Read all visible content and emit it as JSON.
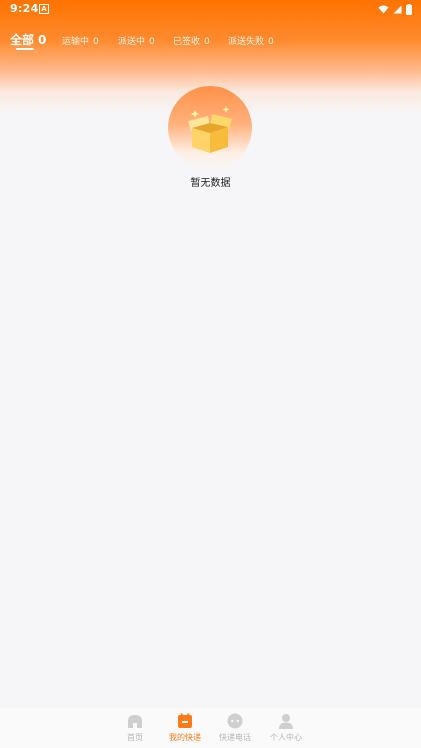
{
  "status_bar": {
    "time": "9:24",
    "notification_icon": "a-icon",
    "right_icons": [
      "wifi-icon",
      "signal-icon",
      "battery-icon"
    ]
  },
  "tabs": [
    {
      "label": "全部",
      "count": "0",
      "active": true
    },
    {
      "label": "运输中",
      "count": "0",
      "active": false
    },
    {
      "label": "派送中",
      "count": "0",
      "active": false
    },
    {
      "label": "已签收",
      "count": "0",
      "active": false
    },
    {
      "label": "派送失败",
      "count": "0",
      "active": false
    }
  ],
  "empty_state": {
    "icon": "open-box-icon",
    "text": "暂无数据"
  },
  "bottom_nav": [
    {
      "label": "首页",
      "icon": "home-icon",
      "active": false
    },
    {
      "label": "我的快递",
      "icon": "package-icon",
      "active": true
    },
    {
      "label": "快递电话",
      "icon": "chat-icon",
      "active": false
    },
    {
      "label": "个人中心",
      "icon": "person-icon",
      "active": false
    }
  ],
  "colors": {
    "accent": "#ff7300",
    "active_nav": "#ff7a1c",
    "inactive_nav": "#b5b5b5",
    "background": "#f6f6f8"
  }
}
